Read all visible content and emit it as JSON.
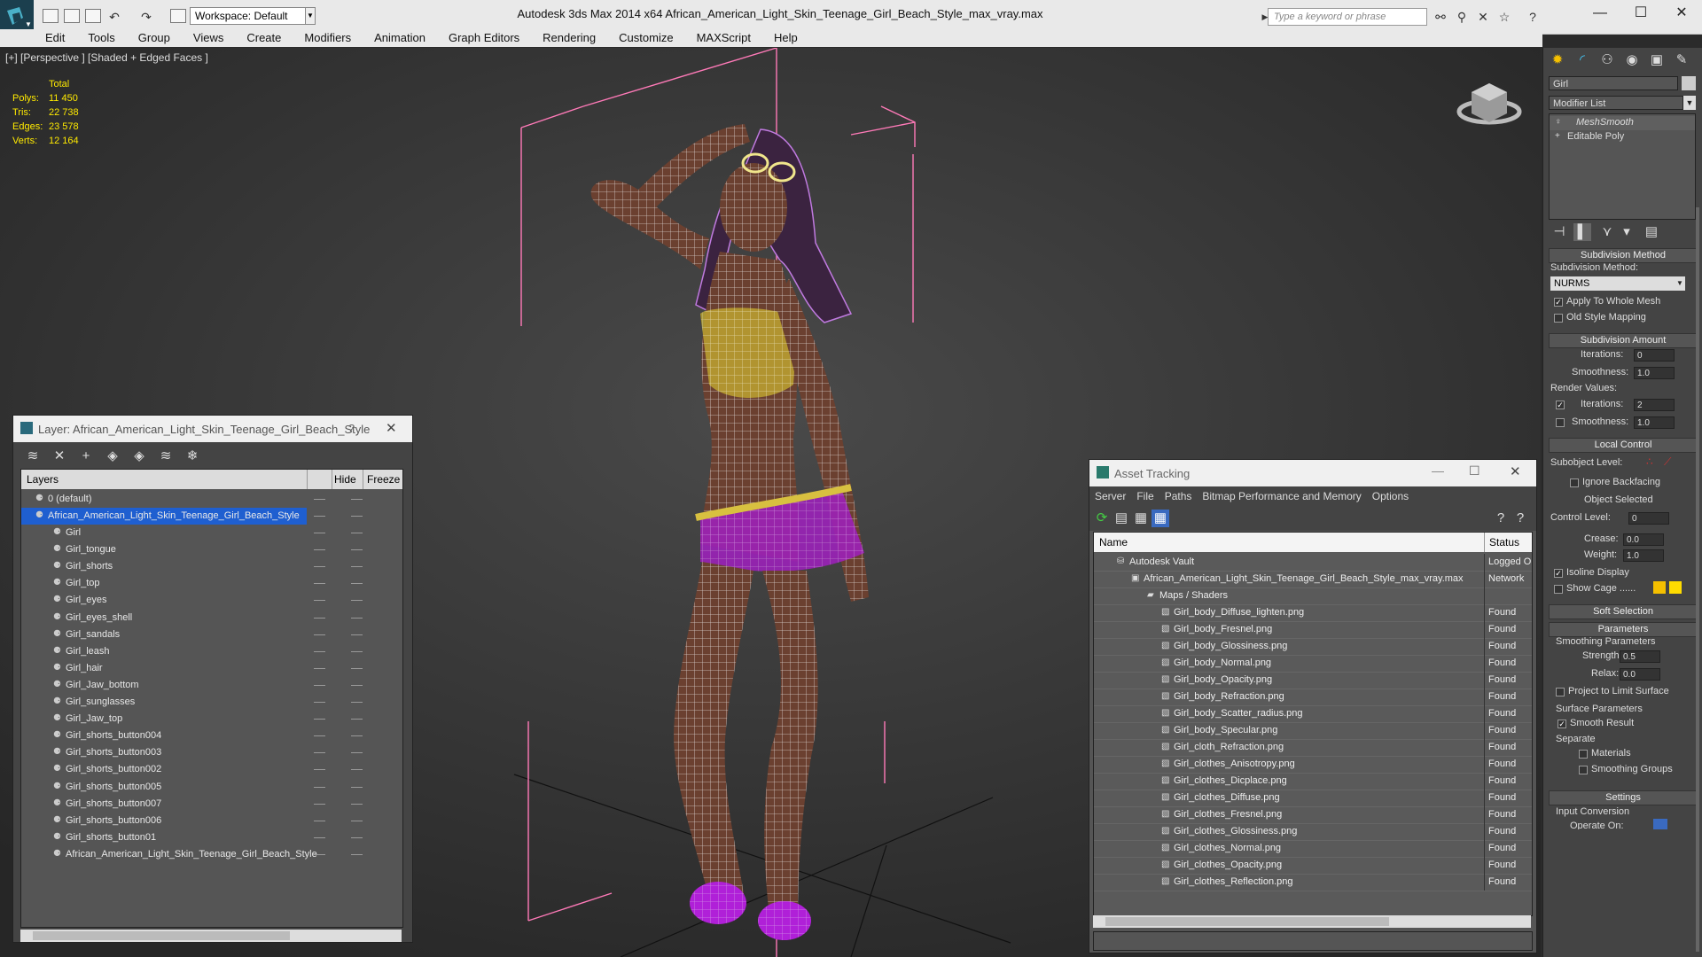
{
  "title_bar": {
    "workspace_label": "Workspace: Default",
    "app_title": "Autodesk 3ds Max  2014 x64     African_American_Light_Skin_Teenage_Girl_Beach_Style_max_vray.max",
    "search_placeholder": "Type a keyword or phrase"
  },
  "menu": [
    "Edit",
    "Tools",
    "Group",
    "Views",
    "Create",
    "Modifiers",
    "Animation",
    "Graph Editors",
    "Rendering",
    "Customize",
    "MAXScript",
    "Help"
  ],
  "viewport": {
    "label": "[+] [Perspective ] [Shaded + Edged Faces ]",
    "stats_header": "Total",
    "stats": [
      {
        "label": "Polys:",
        "value": "11 450"
      },
      {
        "label": "Tris:",
        "value": "22 738"
      },
      {
        "label": "Edges:",
        "value": "23 578"
      },
      {
        "label": "Verts:",
        "value": "12 164"
      }
    ]
  },
  "layer_dialog": {
    "title": "Layer: African_American_Light_Skin_Teenage_Girl_Beach_Style",
    "help": "?",
    "columns": {
      "layers": "Layers",
      "hide": "Hide",
      "freeze": "Freeze"
    },
    "default_layer": "0 (default)",
    "active_layer": "African_American_Light_Skin_Teenage_Girl_Beach_Style",
    "objects": [
      "Girl",
      "Girl_tongue",
      "Girl_shorts",
      "Girl_top",
      "Girl_eyes",
      "Girl_eyes_shell",
      "Girl_sandals",
      "Girl_leash",
      "Girl_hair",
      "Girl_Jaw_bottom",
      "Girl_sunglasses",
      "Girl_Jaw_top",
      "Girl_shorts_button004",
      "Girl_shorts_button003",
      "Girl_shorts_button002",
      "Girl_shorts_button005",
      "Girl_shorts_button007",
      "Girl_shorts_button006",
      "Girl_shorts_button01",
      "African_American_Light_Skin_Teenage_Girl_Beach_Style"
    ]
  },
  "asset_dialog": {
    "title": "Asset Tracking",
    "menu": [
      "Server",
      "File",
      "Paths",
      "Bitmap Performance and Memory",
      "Options"
    ],
    "columns": {
      "name": "Name",
      "status": "Status"
    },
    "vault": {
      "name": "Autodesk Vault",
      "status": "Logged O"
    },
    "file": {
      "name": "African_American_Light_Skin_Teenage_Girl_Beach_Style_max_vray.max",
      "status": "Network"
    },
    "folder": "Maps / Shaders",
    "maps": [
      {
        "name": "Girl_body_Diffuse_lighten.png",
        "status": "Found"
      },
      {
        "name": "Girl_body_Fresnel.png",
        "status": "Found"
      },
      {
        "name": "Girl_body_Glossiness.png",
        "status": "Found"
      },
      {
        "name": "Girl_body_Normal.png",
        "status": "Found"
      },
      {
        "name": "Girl_body_Opacity.png",
        "status": "Found"
      },
      {
        "name": "Girl_body_Refraction.png",
        "status": "Found"
      },
      {
        "name": "Girl_body_Scatter_radius.png",
        "status": "Found"
      },
      {
        "name": "Girl_body_Specular.png",
        "status": "Found"
      },
      {
        "name": "Girl_cloth_Refraction.png",
        "status": "Found"
      },
      {
        "name": "Girl_clothes_Anisotropy.png",
        "status": "Found"
      },
      {
        "name": "Girl_clothes_Dicplace.png",
        "status": "Found"
      },
      {
        "name": "Girl_clothes_Diffuse.png",
        "status": "Found"
      },
      {
        "name": "Girl_clothes_Fresnel.png",
        "status": "Found"
      },
      {
        "name": "Girl_clothes_Glossiness.png",
        "status": "Found"
      },
      {
        "name": "Girl_clothes_Normal.png",
        "status": "Found"
      },
      {
        "name": "Girl_clothes_Opacity.png",
        "status": "Found"
      },
      {
        "name": "Girl_clothes_Reflection.png",
        "status": "Found"
      }
    ]
  },
  "command_panel": {
    "object_name": "Girl",
    "modifier_list": "Modifier List",
    "stack": [
      "MeshSmooth",
      "Editable Poly"
    ],
    "subdivision_method": {
      "header": "Subdivision Method",
      "label": "Subdivision Method:",
      "value": "NURMS",
      "apply_whole": "Apply To Whole Mesh",
      "old_style": "Old Style Mapping"
    },
    "subdivision_amount": {
      "header": "Subdivision Amount",
      "iterations_label": "Iterations:",
      "iterations": "0",
      "smoothness_label": "Smoothness:",
      "smoothness": "1.0",
      "render_values": "Render Values:",
      "r_iterations": "2",
      "r_smoothness": "1.0"
    },
    "local_control": {
      "header": "Local Control",
      "subobject": "Subobject Level:",
      "ignore_backfacing": "Ignore Backfacing",
      "object_selected": "Object Selected",
      "control_level": "Control Level:",
      "control_level_value": "0",
      "crease": "Crease:",
      "crease_value": "0.0",
      "weight": "Weight:",
      "weight_value": "1.0",
      "isoline": "Isoline Display",
      "show_cage": "Show Cage ......"
    },
    "soft_selection": "Soft Selection",
    "parameters": {
      "header": "Parameters",
      "smoothing": "Smoothing Parameters",
      "strength": "Strength:",
      "strength_value": "0.5",
      "relax": "Relax:",
      "relax_value": "0.0",
      "project": "Project to Limit Surface",
      "surface": "Surface Parameters",
      "smooth_result": "Smooth Result",
      "separate": "Separate",
      "materials": "Materials",
      "smoothing_groups": "Smoothing Groups"
    },
    "settings": {
      "header": "Settings",
      "input_conversion": "Input Conversion",
      "operate_on": "Operate On:"
    }
  },
  "colors": {
    "stats": "#ffea00",
    "wire": "#ffffff",
    "bbox": "#ff6fae",
    "selection": "#1f5fd0"
  }
}
